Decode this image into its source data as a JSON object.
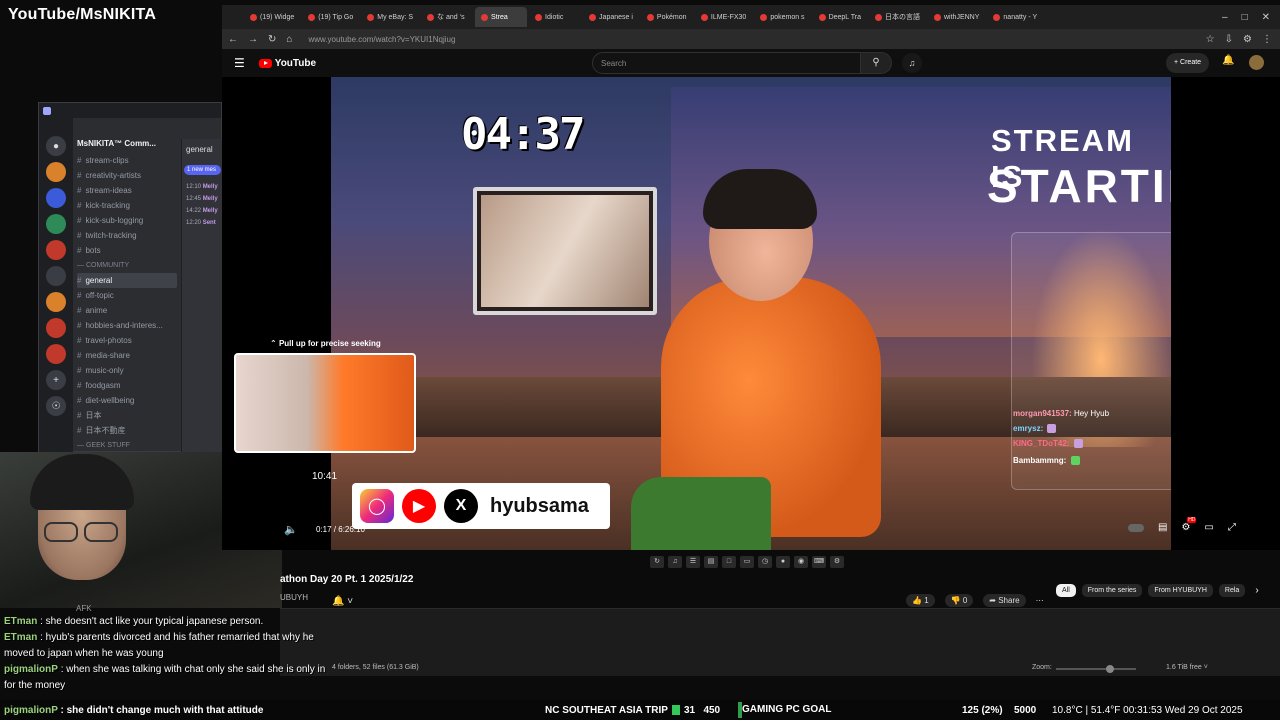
{
  "overlay": {
    "title": "YouTube/MsNIKITA"
  },
  "discord": {
    "server_name": "MsNIKITA™ Comm...",
    "channel_tab": "general",
    "new_messages": "1 new mes",
    "channels": [
      {
        "label": "stream-clips",
        "type": "channel"
      },
      {
        "label": "creativity-artists",
        "type": "channel"
      },
      {
        "label": "stream-ideas",
        "type": "channel"
      },
      {
        "label": "kick-tracking",
        "type": "channel"
      },
      {
        "label": "kick-sub-logging",
        "type": "channel"
      },
      {
        "label": "twitch-tracking",
        "type": "channel"
      },
      {
        "label": "bots",
        "type": "channel"
      },
      {
        "label": "COMMUNITY",
        "type": "category"
      },
      {
        "label": "general",
        "type": "active"
      },
      {
        "label": "off-topic",
        "type": "channel"
      },
      {
        "label": "anime",
        "type": "channel"
      },
      {
        "label": "hobbies-and-interes...",
        "type": "channel"
      },
      {
        "label": "travel-photos",
        "type": "channel"
      },
      {
        "label": "media-share",
        "type": "channel"
      },
      {
        "label": "music-only",
        "type": "channel"
      },
      {
        "label": "foodgasm",
        "type": "channel"
      },
      {
        "label": "diet-wellbeing",
        "type": "channel"
      },
      {
        "label": "日本",
        "type": "channel"
      },
      {
        "label": "日本不動産",
        "type": "channel"
      },
      {
        "label": "GEEK STUFF",
        "type": "category"
      }
    ],
    "chat_lines": [
      {
        "time": "12:10",
        "user": "Melly"
      },
      {
        "time": "12:45",
        "user": "Melly"
      },
      {
        "time": "14:22",
        "user": "Melly"
      },
      {
        "time": "12:20",
        "user": "Sent"
      }
    ]
  },
  "webcam": {
    "status": "AFK"
  },
  "browser": {
    "tabs": [
      {
        "label": "(19) Widge",
        "active": false
      },
      {
        "label": "(19) Tip Go",
        "active": false
      },
      {
        "label": "My eBay: S",
        "active": false
      },
      {
        "label": "な and ‘s",
        "active": false
      },
      {
        "label": "Strea",
        "active": true
      },
      {
        "label": "Idiotic",
        "active": false
      },
      {
        "label": "Japanese i",
        "active": false
      },
      {
        "label": "Pokémon",
        "active": false
      },
      {
        "label": "ILME-FX30",
        "active": false
      },
      {
        "label": "pokemon s",
        "active": false
      },
      {
        "label": "DeepL Tra",
        "active": false
      },
      {
        "label": "日本の言語",
        "active": false
      },
      {
        "label": "withJENNY",
        "active": false
      },
      {
        "label": "nanatty - Y",
        "active": false
      }
    ],
    "url": "www.youtube.com/watch?v=YKUI1Nqjiug"
  },
  "youtube": {
    "logo": "YouTube",
    "search_placeholder": "Search",
    "create_label": "Create",
    "video": {
      "countdown": "04:37",
      "headline_1": "STREAM IS",
      "headline_2": "STARTING",
      "seek_hint": "Pull up for precise seeking",
      "seek_time": "10:41",
      "social_handle": "hyubsama",
      "time_display": "0:17 / 6:26:10",
      "chat": [
        {
          "user": "morgan941537:",
          "text": "Hey Hyub",
          "emote": ""
        },
        {
          "user": "emrysz:",
          "text": "",
          "emote": "emote"
        },
        {
          "user": "KING_TDoT42:",
          "text": "",
          "emote": "emote"
        },
        {
          "user": "Bambammng:",
          "text": "",
          "emote": "green"
        }
      ]
    },
    "title": "athon Day 20 Pt. 1 2025/1/22",
    "channel": "UBUYH",
    "actions": {
      "likes": "1",
      "dislikes": "0",
      "share": "Share"
    },
    "chips": [
      {
        "label": "All",
        "active": true
      },
      {
        "label": "From the series",
        "active": false
      },
      {
        "label": "From HYUBUYH",
        "active": false
      },
      {
        "label": "Rela",
        "active": false
      }
    ]
  },
  "file_explorer": {
    "status": "4 folders, 52 files (61.3 GiB)",
    "zoom_label": "Zoom:",
    "zoom_level": 0.6,
    "free_space": "1.6 TiB free"
  },
  "stream_chat": [
    {
      "user": "ETman",
      "text": ": she doesn't act like your typical japanese person."
    },
    {
      "user": "ETman",
      "text": ": hyub's parents divorced and his father remarried that why he moved to japan when he was young"
    },
    {
      "user": "pigmalionP",
      "text": ": when she was talking with chat only she said she is only in for the money"
    }
  ],
  "ticker": {
    "chat_user": "pigmalionP",
    "chat_text": ": she didn't change much with that attitude",
    "trip": "NC SOUTHEAT ASIA TRIP",
    "trip_count": "31",
    "trip_amount": "450",
    "goal_label": "GAMING PC GOAL",
    "goal_count": "125 (2%)",
    "goal_fraction": 0.02,
    "goal_target": "5000",
    "status": "10.8°C | 51.4°F 00:31:53  Wed 29 Oct 2025"
  }
}
